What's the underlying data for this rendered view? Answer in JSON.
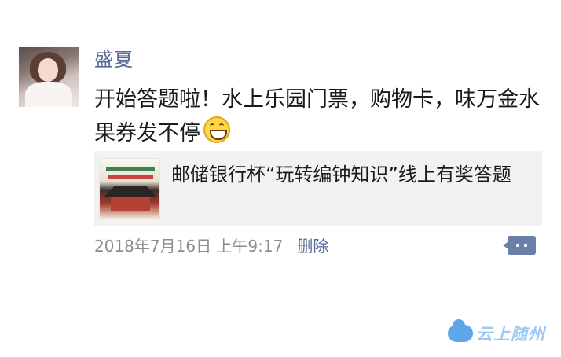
{
  "post": {
    "author_name": "盛夏",
    "text": "开始答题啦！水上乐园门票，购物卡，味万金水果券发不停",
    "emoji_icon": "grinning-face-emoji",
    "shared_link": {
      "title": "邮储银行杯“玩转编钟知识”线上有奖答题"
    },
    "timestamp": "2018年7月16日 上午9:17",
    "delete_label": "删除"
  },
  "watermark": {
    "text": "云上随州",
    "icon": "cloud-icon"
  }
}
